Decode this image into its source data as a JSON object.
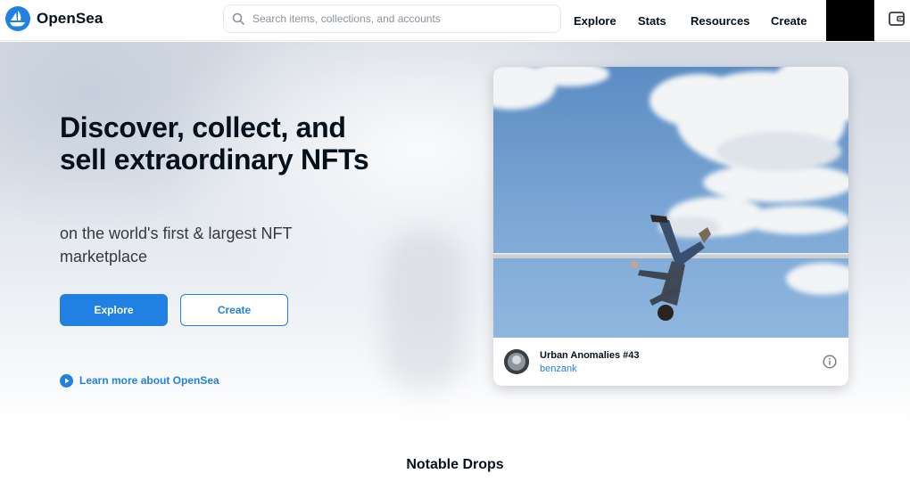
{
  "header": {
    "brand": "OpenSea",
    "search_placeholder": "Search items, collections, and accounts",
    "nav": {
      "explore": "Explore",
      "stats": "Stats",
      "resources": "Resources",
      "create": "Create"
    },
    "icons": {
      "logo": "opensea-logo-icon",
      "search": "search-icon",
      "wallet": "wallet-icon"
    }
  },
  "hero": {
    "title": "Discover, collect, and sell extraordinary NFTs",
    "subtitle": "on the world's first & largest NFT marketplace",
    "explore_button": "Explore",
    "create_button": "Create",
    "learn_more": "Learn more about OpenSea"
  },
  "featured": {
    "name": "Urban Anomalies #43",
    "creator": "benzank"
  },
  "sections": {
    "notable_drops": "Notable Drops"
  },
  "colors": {
    "accent": "#2081e2",
    "text": "#04111d",
    "subtext": "#353840"
  }
}
